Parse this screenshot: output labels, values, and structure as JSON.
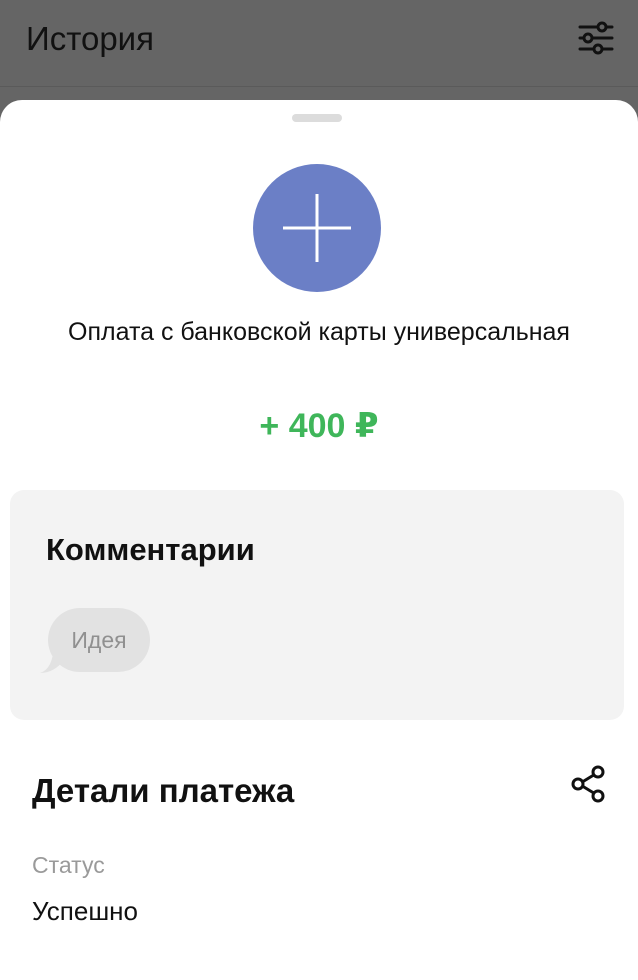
{
  "header": {
    "title": "История",
    "filter_icon": "sliders-icon"
  },
  "transaction": {
    "icon": "plus-icon",
    "icon_color": "#6b7fc6",
    "title": "Оплата с банковской карты универсальная",
    "amount": "+ 400 ₽",
    "amount_color": "#3fb65a"
  },
  "comments": {
    "title": "Комментарии",
    "placeholder": "Идея"
  },
  "details": {
    "title": "Детали платежа",
    "share_icon": "share-icon",
    "status_label": "Статус",
    "status_value": "Успешно"
  }
}
